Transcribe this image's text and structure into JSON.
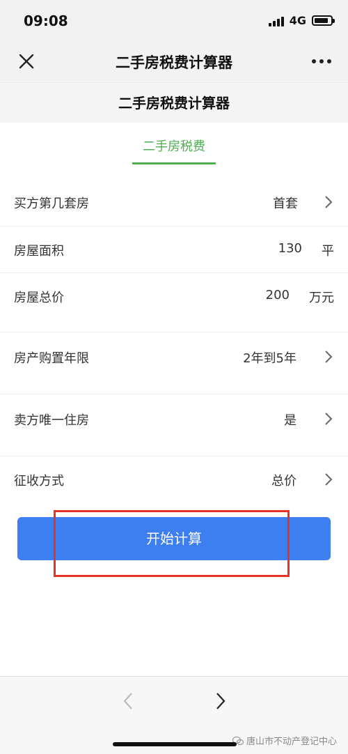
{
  "status_bar": {
    "time": "09:08",
    "network": "4G",
    "battery_level": 0.85
  },
  "navbar": {
    "title": "二手房税费计算器",
    "close_icon": "close-icon",
    "more_icon": "more-icon"
  },
  "page": {
    "title": "二手房税费计算器"
  },
  "tabs": [
    {
      "label": "二手房税费",
      "active": true
    }
  ],
  "form": {
    "buyer_house_number": {
      "label": "买方第几套房",
      "value": "首套"
    },
    "area": {
      "label": "房屋面积",
      "value": "130",
      "unit": "平"
    },
    "total_price": {
      "label": "房屋总价",
      "value": "200",
      "unit": "万元"
    },
    "holding_years": {
      "label": "房产购置年限",
      "value": "2年到5年"
    },
    "only_house": {
      "label": "卖方唯一住房",
      "value": "是"
    },
    "levy_method": {
      "label": "征收方式",
      "value": "总价"
    }
  },
  "calc_button": {
    "label": "开始计算"
  },
  "colors": {
    "accent_green": "#4caf50",
    "button_blue": "#3d7ef0",
    "highlight_red": "#e53423"
  },
  "bottom": {
    "watermark": "唐山市不动产登记中心"
  }
}
